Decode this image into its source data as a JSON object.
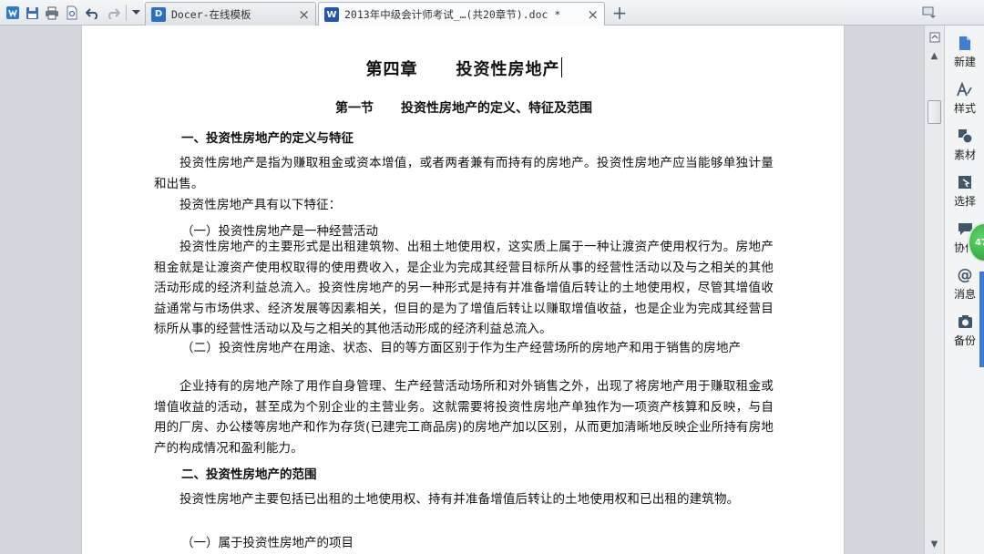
{
  "quick_access": {
    "icons": [
      "wps-logo-icon",
      "save-icon",
      "print-icon",
      "print-preview-icon",
      "undo-icon",
      "redo-icon",
      "dropdown-icon"
    ]
  },
  "tabs": [
    {
      "icon_letter": "D",
      "label": "Docer-在线模板",
      "icon_color": "#2d6fbf"
    },
    {
      "icon_letter": "W",
      "label": "2013年中级会计师考试_…(共20章节).doc *",
      "icon_color": "#2456a8"
    }
  ],
  "document": {
    "chapter_number": "第四章",
    "chapter_title": "投资性房地产",
    "section_number": "第一节",
    "section_title": "投资性房地产的定义、特征及范围",
    "heading1": "一、投资性房地产的定义与特征",
    "para1": "投资性房地产是指为赚取租金或资本增值，或者两者兼有而持有的房地产。投资性房地产应当能够单独计量和出售。",
    "para2": "投资性房地产具有以下特征：",
    "sub1": "（一）投资性房地产是一种经营活动",
    "para3": "投资性房地产的主要形式是出租建筑物、出租土地使用权，这实质上属于一种让渡资产使用权行为。房地产租金就是让渡资产使用权取得的使用费收入，是企业为完成其经营目标所从事的经营性活动以及与之相关的其他活动形成的经济利益总流入。投资性房地产的另一种形式是持有并准备增值后转让的土地使用权，尽管其增值收益通常与市场供求、经济发展等因素相关，但目的是为了增值后转让以赚取增值收益，也是企业为完成其经营目标所从事的经营性活动以及与之相关的其他活动形成的经济利益总流入。",
    "sub2": "（二）投资性房地产在用途、状态、目的等方面区别于作为生产经营场所的房地产和用于销售的房地产",
    "para4": "企业持有的房地产除了用作自身管理、生产经营活动场所和对外销售之外，出现了将房地产用于赚取租金或增值收益的活动，甚至成为个别企业的主营业务。这就需要将投资性房地产单独作为一项资产核算和反映，与自用的厂房、办公楼等房地产和作为存货(已建完工商品房)的房地产加以区别，从而更加清晰地反映企业所持有房地产的构成情况和盈利能力。",
    "heading2": "二、投资性房地产的范围",
    "para5": "投资性房地产主要包括已出租的土地使用权、持有并准备增值后转让的土地使用权和已出租的建筑物。",
    "sub3": "（一）属于投资性房地产的项目"
  },
  "right_panel": [
    {
      "label": "新建",
      "icon": "new-doc-icon"
    },
    {
      "label": "样式",
      "icon": "style-icon"
    },
    {
      "label": "素材",
      "icon": "material-icon"
    },
    {
      "label": "选择",
      "icon": "select-icon"
    },
    {
      "label": "协作",
      "icon": "collab-icon"
    },
    {
      "label": "消息",
      "icon": "message-icon"
    },
    {
      "label": "备份",
      "icon": "backup-icon"
    }
  ],
  "bubble_text": "47"
}
